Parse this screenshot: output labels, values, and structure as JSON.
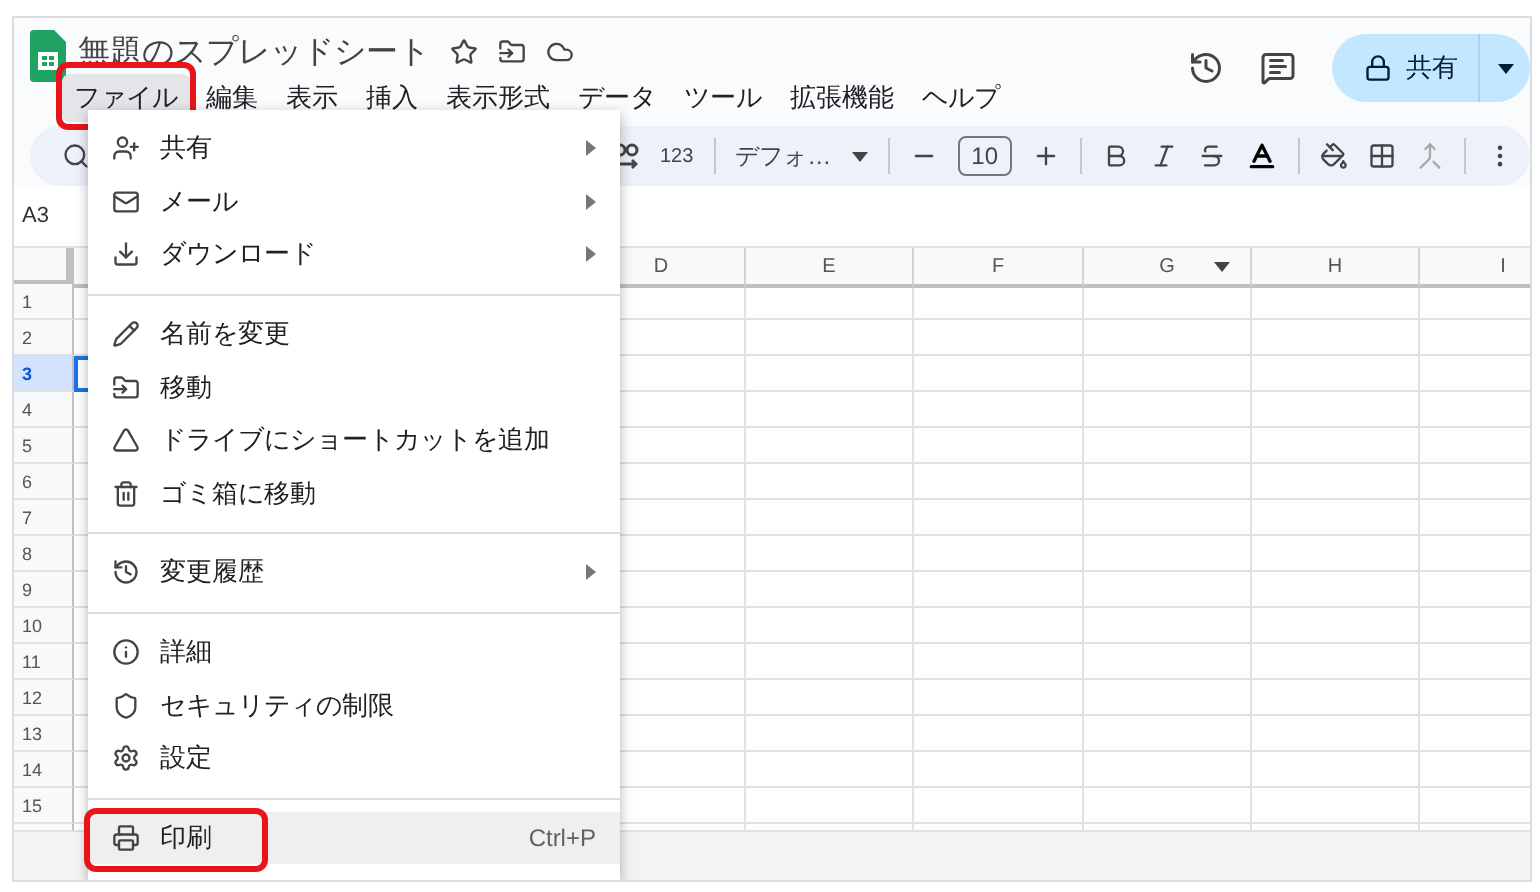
{
  "document": {
    "title": "無題のスプレッドシート"
  },
  "menubar": [
    {
      "label": "ファイル",
      "selected": true,
      "highlighted": true
    },
    {
      "label": "編集",
      "selected": false,
      "highlighted": false
    },
    {
      "label": "表示",
      "selected": false,
      "highlighted": false
    },
    {
      "label": "挿入",
      "selected": false,
      "highlighted": false
    },
    {
      "label": "表示形式",
      "selected": false,
      "highlighted": false
    },
    {
      "label": "データ",
      "selected": false,
      "highlighted": false
    },
    {
      "label": "ツール",
      "selected": false,
      "highlighted": false
    },
    {
      "label": "拡張機能",
      "selected": false,
      "highlighted": false
    },
    {
      "label": "ヘルプ",
      "selected": false,
      "highlighted": false
    }
  ],
  "share_button": {
    "label": "共有"
  },
  "toolbar": {
    "number_format": "123",
    "font": "デフォ…",
    "font_size": "10"
  },
  "name_box": "A3",
  "columns": [
    {
      "label": "D",
      "dropdown": false
    },
    {
      "label": "E",
      "dropdown": false
    },
    {
      "label": "F",
      "dropdown": false
    },
    {
      "label": "G",
      "dropdown": true
    },
    {
      "label": "H",
      "dropdown": false
    },
    {
      "label": "I",
      "dropdown": false
    }
  ],
  "rows": [
    {
      "label": "1",
      "selected": false
    },
    {
      "label": "2",
      "selected": false
    },
    {
      "label": "3",
      "selected": true
    },
    {
      "label": "4",
      "selected": false
    },
    {
      "label": "5",
      "selected": false
    },
    {
      "label": "6",
      "selected": false
    },
    {
      "label": "7",
      "selected": false
    },
    {
      "label": "8",
      "selected": false
    },
    {
      "label": "9",
      "selected": false
    },
    {
      "label": "10",
      "selected": false
    },
    {
      "label": "11",
      "selected": false
    },
    {
      "label": "12",
      "selected": false
    },
    {
      "label": "13",
      "selected": false
    },
    {
      "label": "14",
      "selected": false
    },
    {
      "label": "15",
      "selected": false
    }
  ],
  "file_menu": [
    {
      "kind": "item",
      "label": "共有",
      "submenu": true,
      "hovered": false,
      "highlighted": false
    },
    {
      "kind": "item",
      "label": "メール",
      "submenu": true,
      "hovered": false,
      "highlighted": false
    },
    {
      "kind": "item",
      "label": "ダウンロード",
      "submenu": true,
      "hovered": false,
      "highlighted": false
    },
    {
      "kind": "divider"
    },
    {
      "kind": "item",
      "label": "名前を変更",
      "submenu": false,
      "hovered": false,
      "highlighted": false
    },
    {
      "kind": "item",
      "label": "移動",
      "submenu": false,
      "hovered": false,
      "highlighted": false
    },
    {
      "kind": "item",
      "label": "ドライブにショートカットを追加",
      "submenu": false,
      "hovered": false,
      "highlighted": false
    },
    {
      "kind": "item",
      "label": "ゴミ箱に移動",
      "submenu": false,
      "hovered": false,
      "highlighted": false
    },
    {
      "kind": "divider"
    },
    {
      "kind": "item",
      "label": "変更履歴",
      "submenu": true,
      "hovered": false,
      "highlighted": false
    },
    {
      "kind": "divider"
    },
    {
      "kind": "item",
      "label": "詳細",
      "submenu": false,
      "hovered": false,
      "highlighted": false
    },
    {
      "kind": "item",
      "label": "セキュリティの制限",
      "submenu": false,
      "hovered": false,
      "highlighted": false
    },
    {
      "kind": "item",
      "label": "設定",
      "submenu": false,
      "hovered": false,
      "highlighted": false
    },
    {
      "kind": "divider"
    },
    {
      "kind": "item",
      "label": "印刷",
      "shortcut": "Ctrl+P",
      "submenu": false,
      "hovered": true,
      "highlighted": true
    }
  ]
}
